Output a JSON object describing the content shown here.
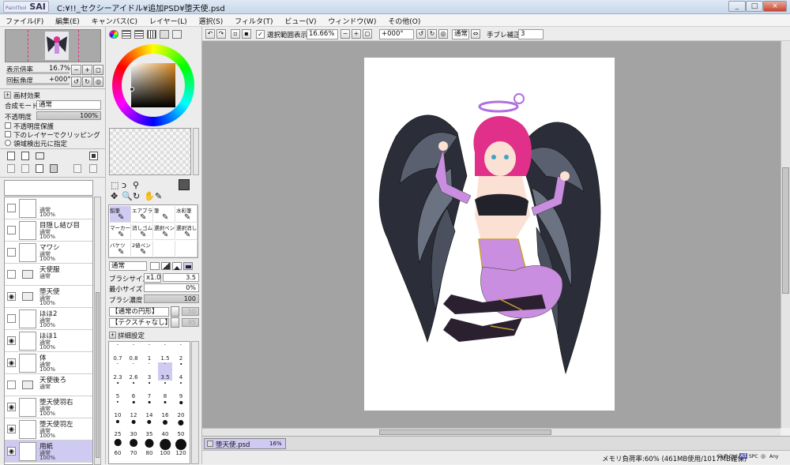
{
  "app": {
    "logo": "SAI",
    "logo_small": "PaintTool",
    "title": "C:¥!!_セクシーアイドル¥追加PSD¥堕天使.psd"
  },
  "window_buttons": [
    "_",
    "□",
    "×"
  ],
  "menu": [
    "ファイル(F)",
    "編集(E)",
    "キャンバス(C)",
    "レイヤー(L)",
    "選択(S)",
    "フィルタ(T)",
    "ビュー(V)",
    "ウィンドウ(W)",
    "その他(O)"
  ],
  "toolbar": {
    "show_selection_label": "選択範囲表示",
    "zoom": "16.66%",
    "rotation": "+000°",
    "mode": "通常",
    "stabilizer_label": "手ブレ補正",
    "stabilizer_value": "3"
  },
  "navigator": {
    "zoom_label": "表示倍率",
    "zoom_value": "16.7%",
    "rotate_label": "回転角度",
    "rotate_value": "+000°"
  },
  "layer_panel": {
    "paper_effect": "画材効果",
    "blend_label": "合成モード",
    "blend_value": "通常",
    "opacity_label": "不透明度",
    "opacity_value": "100%",
    "protect_alpha": "不透明度保護",
    "clip_below": "下のレイヤーでクリッピング",
    "selection_source": "領域検出元に指定"
  },
  "layers": [
    {
      "name": "",
      "mode": "通常",
      "opacity": "100%",
      "type": "layer",
      "visible": false
    },
    {
      "name": "目隠し結び目",
      "mode": "通常",
      "opacity": "100%",
      "type": "layer",
      "visible": false
    },
    {
      "name": "マワシ",
      "mode": "通常",
      "opacity": "100%",
      "type": "layer",
      "visible": false
    },
    {
      "name": "天使服",
      "mode": "通常",
      "opacity": "",
      "type": "folder",
      "visible": false
    },
    {
      "name": "堕天使",
      "mode": "通常",
      "opacity": "100%",
      "type": "folder",
      "visible": true
    },
    {
      "name": "ほほ2",
      "mode": "通常",
      "opacity": "100%",
      "type": "layer",
      "visible": false
    },
    {
      "name": "ほほ1",
      "mode": "通常",
      "opacity": "100%",
      "type": "layer",
      "visible": true
    },
    {
      "name": "体",
      "mode": "通常",
      "opacity": "100%",
      "type": "layer",
      "visible": true
    },
    {
      "name": "天使後ろ",
      "mode": "通常",
      "opacity": "",
      "type": "folder",
      "visible": false
    },
    {
      "name": "堕天使羽右",
      "mode": "通常",
      "opacity": "100%",
      "type": "layer",
      "visible": true
    },
    {
      "name": "堕天使羽左",
      "mode": "通常",
      "opacity": "100%",
      "type": "layer",
      "visible": true
    },
    {
      "name": "用紙",
      "mode": "通常",
      "opacity": "100%",
      "type": "layer",
      "visible": true,
      "selected": true
    }
  ],
  "tools": {
    "rows": [
      [
        "鉛筆",
        "エアブラシ",
        "筆",
        "水彩筆"
      ],
      [
        "マーカー",
        "消しゴム",
        "選択ペン",
        "選択消し"
      ],
      [
        "バケツ",
        "2値ペン",
        "",
        ""
      ]
    ],
    "blend_mode": "通常",
    "brush_size_label": "ブラシサイズ",
    "brush_size_mult": "x1.0",
    "brush_size_value": "3.5",
    "min_size_label": "最小サイズ",
    "min_size_value": "0%",
    "density_label": "ブラシ濃度",
    "density_value": "100",
    "shape": "【通常の円形】",
    "shape_value": "50",
    "texture": "【テクスチャなし】",
    "texture_value": "95",
    "details": "詳細設定",
    "presets": [
      "0.7",
      "0.8",
      "1",
      "1.5",
      "2",
      "2.3",
      "2.6",
      "3",
      "3.5",
      "4",
      "5",
      "6",
      "7",
      "8",
      "9",
      "10",
      "12",
      "14",
      "16",
      "20",
      "25",
      "30",
      "35",
      "40",
      "50",
      "60",
      "70",
      "80",
      "100",
      "120"
    ],
    "selected_preset": "3.5"
  },
  "doc_tab": {
    "name": "堕天使.psd",
    "zoom": "16%"
  },
  "status": {
    "memory": "メモリ負荷率:60% (461MB使用/1017MB確保)",
    "keys": [
      "Shift",
      "Ctrl",
      "Alt",
      "SPC",
      "◎",
      "Any"
    ]
  },
  "colors": {
    "accent": "#cfcaf2",
    "canvas_bg": "#a3a3a3",
    "wing": "#2a2d36",
    "hair": "#e0308a",
    "outfit": "#c98ee0"
  }
}
